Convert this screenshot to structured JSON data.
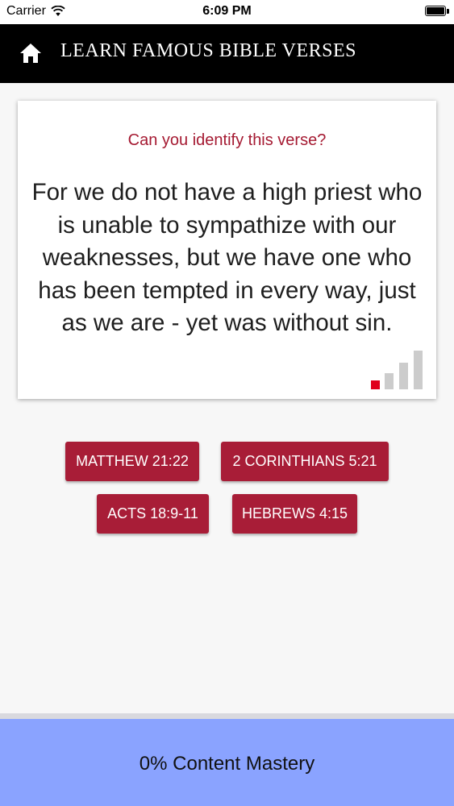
{
  "status_bar": {
    "carrier": "Carrier",
    "time": "6:09 PM"
  },
  "header": {
    "title": "LEARN FAMOUS BIBLE VERSES",
    "home_icon": "home-icon"
  },
  "card": {
    "prompt": "Can you identify this verse?",
    "verse": "For we do not have a high priest who is unable to sympathize with our weaknesses, but we have one who has been tempted in every way, just as we are - yet was without sin.",
    "strength_level": 1,
    "strength_max": 4,
    "colors": {
      "prompt": "#a51a32",
      "strength_active": "#e0001b",
      "strength_inactive": "#cccccc"
    }
  },
  "answers": [
    {
      "label": "MATTHEW 21:22"
    },
    {
      "label": "2 CORINTHIANS 5:21"
    },
    {
      "label": "ACTS 18:9-11"
    },
    {
      "label": "HEBREWS 4:15"
    }
  ],
  "footer": {
    "mastery": "0% Content Mastery"
  },
  "colors": {
    "header_bg": "#000000",
    "button_bg": "#a81d37",
    "footer_bg": "#8aa3ff"
  }
}
